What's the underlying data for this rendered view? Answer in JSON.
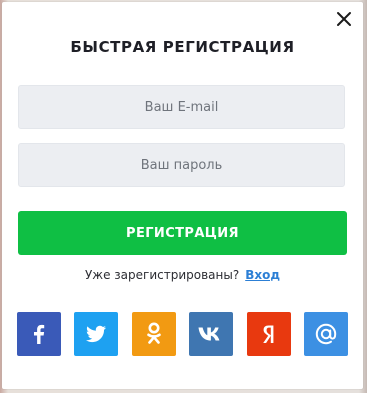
{
  "modal": {
    "title": "БЫСТРАЯ РЕГИСТРАЦИЯ",
    "email_placeholder": "Ваш E-mail",
    "password_placeholder": "Ваш пароль",
    "register_label": "РЕГИСТРАЦИЯ",
    "already_registered": "Уже зарегистрированы?",
    "login_link": "Вход"
  },
  "socials": [
    {
      "name": "facebook",
      "icon": "facebook-icon",
      "color": "#3a5ab8"
    },
    {
      "name": "twitter",
      "icon": "twitter-icon",
      "color": "#1ea1f1"
    },
    {
      "name": "odnoklassniki",
      "icon": "odnoklassniki-icon",
      "color": "#f29a12"
    },
    {
      "name": "vkontakte",
      "icon": "vk-icon",
      "color": "#3f76b1"
    },
    {
      "name": "yandex",
      "icon": "yandex-icon",
      "color": "#e8390f"
    },
    {
      "name": "mail",
      "icon": "at-sign-icon",
      "color": "#3c90e3"
    }
  ],
  "colors": {
    "accent_green": "#0fbf44",
    "link_blue": "#2c7fd5",
    "input_bg": "#eceef2"
  }
}
